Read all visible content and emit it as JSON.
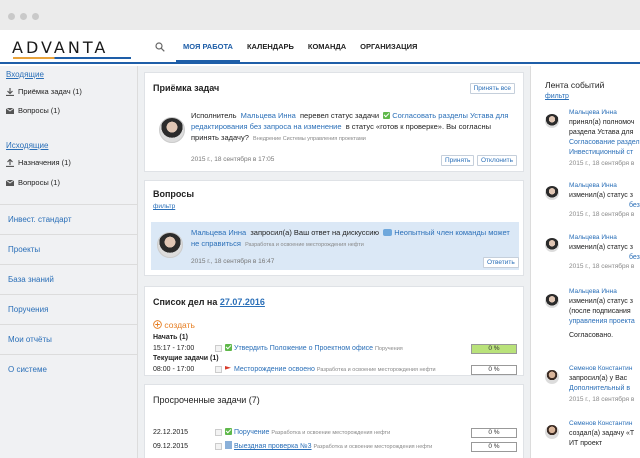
{
  "header": {
    "logo": "ADVANTA",
    "nav": [
      "МОЯ РАБОТА",
      "КАЛЕНДАРЬ",
      "КОМАНДА",
      "ОРГАНИЗАЦИЯ"
    ]
  },
  "sidebar": {
    "incoming": "Входящие",
    "incoming_items": [
      "Приёмка задач (1)",
      "Вопросы (1)"
    ],
    "outgoing": "Исходящие",
    "outgoing_items": [
      "Назначения (1)",
      "Вопросы (1)"
    ],
    "links": [
      "Инвест. стандарт",
      "Проекты",
      "База знаний",
      "Поручения",
      "Мои отчёты",
      "О системе"
    ]
  },
  "acceptance": {
    "title": "Приёмка задач",
    "accept_all": "Принять все",
    "prefix": "Исполнитель",
    "person": "Мальцева Инна",
    "mid": "перевел статус задачи",
    "task": "Согласовать разделы Устава для редактирования без запроса на изменение",
    "suffix": "в статус «готов к проверке». Вы согласны принять задачу?",
    "source": "Внедрение Системы управления проектами",
    "date": "2015 г., 18 сентября в 17:05",
    "accept": "Принять",
    "reject": "Отклонить"
  },
  "questions": {
    "title": "Вопросы",
    "filter": "фильтр",
    "person": "Мальцева Инна",
    "mid": "запросил(а) Ваш ответ на дискуссию",
    "topic": "Неопытный член команды может не справиться",
    "project": "Разработка и освоение месторождения нефти",
    "date": "2015 г., 18 сентября в 16:47",
    "reply": "Ответить"
  },
  "todo": {
    "title_prefix": "Список дел на",
    "title_date": "27.07.2016",
    "create": "создать",
    "start_label": "Начать (1)",
    "current_label": "Текущие задачи (1)",
    "rows": [
      {
        "time": "15:17 - 17:00",
        "task": "Утвердить Положение о Проектном офисе",
        "meta": "Поручения",
        "pct": "0 %"
      },
      {
        "time": "08:00 - 17:00",
        "task": "Месторождение освоено",
        "meta": "Разработка и освоение месторождения нефти",
        "pct": "0 %"
      }
    ]
  },
  "overdue": {
    "title": "Просроченные задачи (7)",
    "rows": [
      {
        "date": "22.12.2015",
        "task": "Поручение",
        "meta": "Разработка и освоение месторождения нефти",
        "pct": "0 %"
      },
      {
        "date": "09.12.2015",
        "task": "Выездная проверка №3",
        "meta": "Разработка и освоение месторождения нефти",
        "pct": "0 %"
      }
    ]
  },
  "feed": {
    "title": "Лента событий",
    "filter": "фильтр",
    "items": [
      {
        "name": "Мальцева Инна",
        "lines": [
          "принял(а) полномоч",
          "раздела Устава для"
        ],
        "blue": [
          "Согласование раздел",
          "Инвестиционный ст"
        ],
        "date": "2015 г., 18 сентября в"
      },
      {
        "name": "Мальцева Инна",
        "lines": [
          "изменил(а) статус з"
        ],
        "blue": [
          "без"
        ],
        "date": "2015 г., 18 сентября в"
      },
      {
        "name": "Мальцева Инна",
        "lines": [
          "изменил(а) статус з"
        ],
        "blue": [
          "без"
        ],
        "date": "2015 г., 18 сентября в"
      },
      {
        "name": "Мальцева Инна",
        "lines": [
          "изменил(а) статус з",
          "(после подписания"
        ],
        "blue": [
          "управления проекта"
        ],
        "date": "Согласовано."
      },
      {
        "name": "Семенов Константин",
        "lines": [
          "запросил(а) у Вас"
        ],
        "blue": [
          "Дополнительный в"
        ],
        "date": "2015 г., 18 сентября в"
      },
      {
        "name": "Семенов Константин",
        "lines": [
          "создал(а) задачу «Т",
          "ИТ проект"
        ],
        "blue": [],
        "date": ""
      }
    ]
  }
}
